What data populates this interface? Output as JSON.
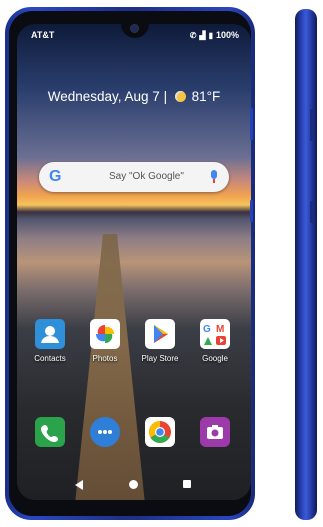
{
  "status_bar": {
    "carrier": "AT&T",
    "battery": "100%"
  },
  "lock_widget": {
    "date": "Wednesday, Aug 7",
    "separator": "|",
    "temperature": "81°F"
  },
  "search_bar": {
    "logo": "G",
    "placeholder": "Say \"Ok Google\""
  },
  "home_apps": [
    {
      "label": "Contacts",
      "icon": "contacts-icon",
      "color": "#2f8fd8"
    },
    {
      "label": "Photos",
      "icon": "photos-icon",
      "color": "#ffffff"
    },
    {
      "label": "Play Store",
      "icon": "play-store-icon",
      "color": "#ffffff"
    },
    {
      "label": "Google",
      "icon": "google-folder-icon",
      "color": "#ffffff"
    }
  ],
  "dock_apps": [
    {
      "icon": "phone-icon",
      "color": "#2aa34a"
    },
    {
      "icon": "messages-icon",
      "color": "#2f7fd8"
    },
    {
      "icon": "chrome-icon",
      "color": "#ffffff"
    },
    {
      "icon": "camera-icon",
      "color": "#9b3aa8"
    }
  ]
}
